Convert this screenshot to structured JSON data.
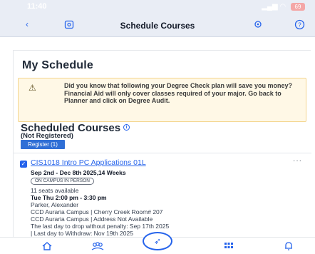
{
  "status": {
    "time": "11:40",
    "battery": "69"
  },
  "nav": {
    "title": "Schedule Courses",
    "back_icon": "chevron-left-icon",
    "help_icon": "help-icon"
  },
  "page": {
    "title": "My Schedule"
  },
  "notice": {
    "icon": "warning-icon",
    "text": "Did you know that following your Degree Check plan will save you money? Financial Aid will only cover classes required of your major. Go back to Planner and click on Degree Audit."
  },
  "scheduled": {
    "title": "Scheduled Courses",
    "subtitle": "(Not Registered)",
    "register_label": "Register (1)"
  },
  "course": {
    "title": "CIS1018 Intro PC Applications 01L",
    "more": "···",
    "dates": "Sep 2nd - Dec 8th 2025,14 Weeks",
    "mode": "On Campus In Person",
    "seats": "11 seats available",
    "schedule": "Tue Thu 2:00 pm - 3:30 pm",
    "instructor": "Parker, Alexander",
    "location1": "CCD Auraria Campus | Cherry Creek Room# 207",
    "location2": "CCD Auraria Campus | Address Not Available",
    "drop1": "The last day to drop without penalty: Sep 17th 2025",
    "drop2": "| Last day to Withdraw: Nov 19th 2025"
  },
  "tabbar": {
    "items": [
      "home-icon",
      "people-icon",
      "rocket-icon",
      "grid-icon",
      "bell-icon"
    ]
  },
  "colors": {
    "accent": "#2563eb",
    "notice_bg": "#fff8e6",
    "navbar_bg": "#e9edf5"
  }
}
